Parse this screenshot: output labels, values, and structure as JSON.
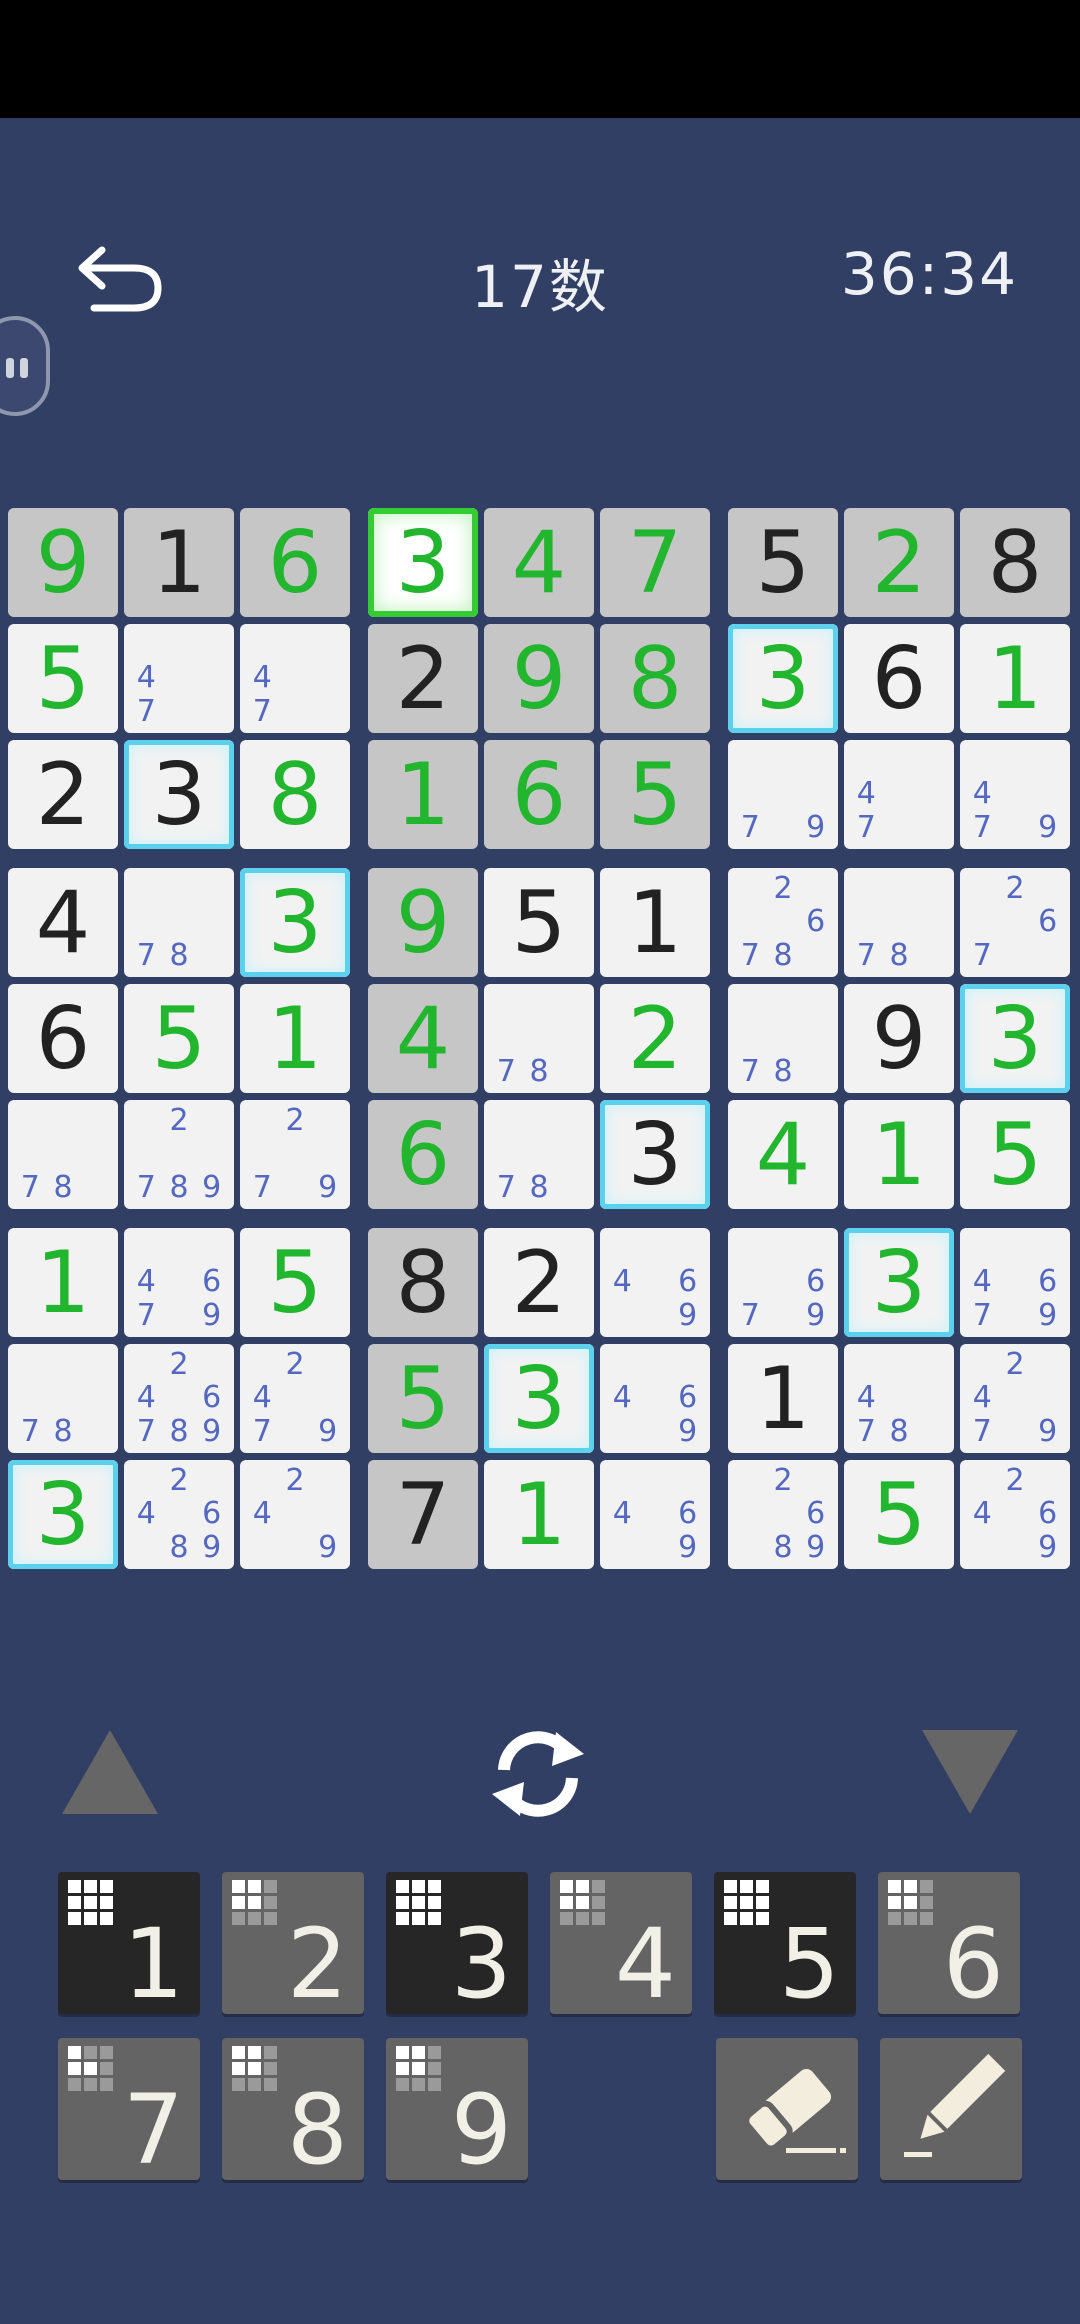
{
  "header": {
    "title": "17数",
    "timer": "36:34"
  },
  "board": [
    [
      {
        "v": "9",
        "t": "u",
        "bg": "g"
      },
      {
        "v": "1",
        "t": "g",
        "bg": "g"
      },
      {
        "v": "6",
        "t": "u",
        "bg": "g"
      },
      {
        "v": "3",
        "t": "u",
        "bg": "sel"
      },
      {
        "v": "4",
        "t": "u",
        "bg": "g"
      },
      {
        "v": "7",
        "t": "u",
        "bg": "g"
      },
      {
        "v": "5",
        "t": "g",
        "bg": "g"
      },
      {
        "v": "2",
        "t": "u",
        "bg": "g"
      },
      {
        "v": "8",
        "t": "g",
        "bg": "g"
      }
    ],
    [
      {
        "v": "5",
        "t": "u"
      },
      {
        "n": [
          "4",
          "7"
        ]
      },
      {
        "n": [
          "4",
          "7"
        ]
      },
      {
        "v": "2",
        "t": "g",
        "bg": "g"
      },
      {
        "v": "9",
        "t": "u",
        "bg": "g"
      },
      {
        "v": "8",
        "t": "u",
        "bg": "g"
      },
      {
        "v": "3",
        "t": "u",
        "bg": "hl"
      },
      {
        "v": "6",
        "t": "g"
      },
      {
        "v": "1",
        "t": "u"
      }
    ],
    [
      {
        "v": "2",
        "t": "g"
      },
      {
        "v": "3",
        "t": "g",
        "bg": "hl"
      },
      {
        "v": "8",
        "t": "u"
      },
      {
        "v": "1",
        "t": "u",
        "bg": "g"
      },
      {
        "v": "6",
        "t": "u",
        "bg": "g"
      },
      {
        "v": "5",
        "t": "u",
        "bg": "g"
      },
      {
        "n": [
          "7",
          "9"
        ]
      },
      {
        "n": [
          "4",
          "7"
        ]
      },
      {
        "n": [
          "4",
          "7",
          "9"
        ]
      }
    ],
    [
      {
        "v": "4",
        "t": "g"
      },
      {
        "n": [
          "7",
          "8"
        ]
      },
      {
        "v": "3",
        "t": "u",
        "bg": "hl"
      },
      {
        "v": "9",
        "t": "u",
        "bg": "g"
      },
      {
        "v": "5",
        "t": "g"
      },
      {
        "v": "1",
        "t": "g"
      },
      {
        "n": [
          "2",
          "6",
          "7",
          "8"
        ]
      },
      {
        "n": [
          "7",
          "8"
        ]
      },
      {
        "n": [
          "2",
          "6",
          "7"
        ]
      }
    ],
    [
      {
        "v": "6",
        "t": "g"
      },
      {
        "v": "5",
        "t": "u"
      },
      {
        "v": "1",
        "t": "u"
      },
      {
        "v": "4",
        "t": "u",
        "bg": "g"
      },
      {
        "n": [
          "7",
          "8"
        ]
      },
      {
        "v": "2",
        "t": "u"
      },
      {
        "n": [
          "7",
          "8"
        ]
      },
      {
        "v": "9",
        "t": "g"
      },
      {
        "v": "3",
        "t": "u",
        "bg": "hl"
      }
    ],
    [
      {
        "n": [
          "7",
          "8"
        ]
      },
      {
        "n": [
          "2",
          "7",
          "8",
          "9"
        ]
      },
      {
        "n": [
          "2",
          "7",
          "9"
        ]
      },
      {
        "v": "6",
        "t": "u",
        "bg": "g"
      },
      {
        "n": [
          "7",
          "8"
        ]
      },
      {
        "v": "3",
        "t": "g",
        "bg": "hl"
      },
      {
        "v": "4",
        "t": "u"
      },
      {
        "v": "1",
        "t": "u"
      },
      {
        "v": "5",
        "t": "u"
      }
    ],
    [
      {
        "v": "1",
        "t": "u"
      },
      {
        "n": [
          "4",
          "6",
          "7",
          "9"
        ]
      },
      {
        "v": "5",
        "t": "u"
      },
      {
        "v": "8",
        "t": "g",
        "bg": "g"
      },
      {
        "v": "2",
        "t": "g"
      },
      {
        "n": [
          "4",
          "6",
          "9"
        ]
      },
      {
        "n": [
          "6",
          "7",
          "9"
        ]
      },
      {
        "v": "3",
        "t": "u",
        "bg": "hl"
      },
      {
        "n": [
          "4",
          "6",
          "7",
          "9"
        ]
      }
    ],
    [
      {
        "n": [
          "7",
          "8"
        ]
      },
      {
        "n": [
          "2",
          "4",
          "6",
          "7",
          "8",
          "9"
        ]
      },
      {
        "n": [
          "2",
          "4",
          "7",
          "9"
        ]
      },
      {
        "v": "5",
        "t": "u",
        "bg": "g"
      },
      {
        "v": "3",
        "t": "u",
        "bg": "hl"
      },
      {
        "n": [
          "4",
          "6",
          "9"
        ]
      },
      {
        "v": "1",
        "t": "g"
      },
      {
        "n": [
          "4",
          "7",
          "8"
        ]
      },
      {
        "n": [
          "2",
          "4",
          "7",
          "9"
        ]
      }
    ],
    [
      {
        "v": "3",
        "t": "u",
        "bg": "hl"
      },
      {
        "n": [
          "2",
          "4",
          "6",
          "8",
          "9"
        ]
      },
      {
        "n": [
          "2",
          "4",
          "9"
        ]
      },
      {
        "v": "7",
        "t": "g",
        "bg": "g"
      },
      {
        "v": "1",
        "t": "u"
      },
      {
        "n": [
          "4",
          "6",
          "9"
        ]
      },
      {
        "n": [
          "2",
          "6",
          "8",
          "9"
        ]
      },
      {
        "v": "5",
        "t": "u"
      },
      {
        "n": [
          "2",
          "4",
          "6",
          "9"
        ]
      }
    ]
  ],
  "keypad": {
    "keys": [
      {
        "label": "1",
        "dark": true,
        "mini": [
          1,
          1,
          1,
          1,
          1,
          1,
          1,
          1,
          1
        ]
      },
      {
        "label": "2",
        "dark": false,
        "mini": [
          1,
          1,
          0,
          1,
          1,
          0,
          0,
          0,
          0
        ]
      },
      {
        "label": "3",
        "dark": true,
        "mini": [
          1,
          1,
          1,
          1,
          1,
          1,
          1,
          1,
          1
        ]
      },
      {
        "label": "4",
        "dark": false,
        "mini": [
          1,
          1,
          0,
          1,
          1,
          0,
          0,
          0,
          0
        ]
      },
      {
        "label": "5",
        "dark": true,
        "mini": [
          1,
          1,
          1,
          1,
          1,
          1,
          1,
          1,
          1
        ]
      },
      {
        "label": "6",
        "dark": false,
        "mini": [
          1,
          1,
          0,
          1,
          1,
          0,
          0,
          0,
          0
        ]
      },
      {
        "label": "7",
        "dark": false,
        "mini": [
          1,
          0,
          0,
          1,
          1,
          0,
          0,
          0,
          0
        ]
      },
      {
        "label": "8",
        "dark": false,
        "mini": [
          1,
          1,
          0,
          1,
          1,
          0,
          0,
          0,
          0
        ]
      },
      {
        "label": "9",
        "dark": false,
        "mini": [
          1,
          1,
          0,
          1,
          1,
          0,
          0,
          0,
          0
        ]
      }
    ]
  },
  "icons": {
    "back": "undo-arrow-icon",
    "rotate": "refresh-icon",
    "eraser": "eraser-icon",
    "pencil": "pencil-icon"
  },
  "colors": {
    "background": "#323f65",
    "user_digit": "#22b52e",
    "given_digit": "#222222",
    "note_digit": "#5468c2",
    "highlight": "#5cd1ee",
    "selected": "#33cc33"
  }
}
